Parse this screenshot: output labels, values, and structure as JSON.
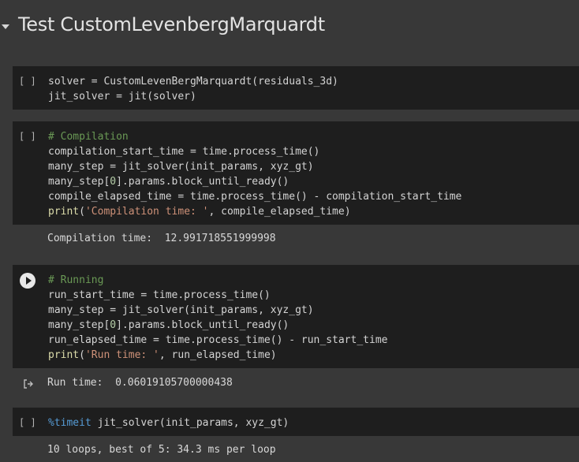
{
  "section": {
    "title": "Test CustomLevenbergMarquardt",
    "collapse_icon": "caret-down-icon"
  },
  "cells": [
    {
      "gutter": "[ ]",
      "lines": [
        [
          {
            "t": "solver = CustomLevenBergMarquardt(residuals_3d)",
            "c": ""
          }
        ],
        [
          {
            "t": "jit_solver = jit(solver)",
            "c": ""
          }
        ]
      ]
    },
    {
      "gutter": "[ ]",
      "lines": [
        [
          {
            "t": "# Compilation",
            "c": "tok-comment"
          }
        ],
        [
          {
            "t": "compilation_start_time = time.process_time()",
            "c": ""
          }
        ],
        [
          {
            "t": "many_step = jit_solver(init_params, xyz_gt)",
            "c": ""
          }
        ],
        [
          {
            "t": "many_step[",
            "c": ""
          },
          {
            "t": "0",
            "c": "tok-number"
          },
          {
            "t": "].params.block_until_ready()",
            "c": ""
          }
        ],
        [
          {
            "t": "compile_elapsed_time = time.process_time() - compilation_start_time",
            "c": ""
          }
        ],
        [
          {
            "t": "print",
            "c": "tok-builtin"
          },
          {
            "t": "(",
            "c": ""
          },
          {
            "t": "'Compilation time: '",
            "c": "tok-string"
          },
          {
            "t": ", compile_elapsed_time)",
            "c": ""
          }
        ]
      ],
      "output": "Compilation time:  12.991718551999998"
    },
    {
      "gutter_icon": "run-cell-icon",
      "lines": [
        [
          {
            "t": "# Running",
            "c": "tok-comment"
          }
        ],
        [
          {
            "t": "run_start_time = time.process_time()",
            "c": ""
          }
        ],
        [
          {
            "t": "many_step = jit_solver(init_params, xyz_gt)",
            "c": ""
          }
        ],
        [
          {
            "t": "many_step[",
            "c": ""
          },
          {
            "t": "0",
            "c": "tok-number"
          },
          {
            "t": "].params.block_until_ready()",
            "c": ""
          }
        ],
        [
          {
            "t": "run_elapsed_time = time.process_time() - run_start_time",
            "c": ""
          }
        ],
        [
          {
            "t": "print",
            "c": "tok-builtin"
          },
          {
            "t": "(",
            "c": ""
          },
          {
            "t": "'Run time: '",
            "c": "tok-string"
          },
          {
            "t": ", run_elapsed_time)",
            "c": ""
          }
        ]
      ],
      "output_icon": "output-arrow-icon",
      "output": "Run time:  0.06019105700000438"
    },
    {
      "gutter": "[ ]",
      "lines": [
        [
          {
            "t": "%timeit",
            "c": "tok-magic"
          },
          {
            "t": " jit_solver(init_params, xyz_gt)",
            "c": ""
          }
        ]
      ],
      "output": "10 loops, best of 5: 34.3 ms per loop"
    }
  ],
  "colors": {
    "background": "#383838",
    "cell_background": "#1e1e1e",
    "comment": "#6a9955",
    "string": "#ce9178",
    "number": "#b5cea8",
    "builtin": "#dcdcaa",
    "magic": "#569cd6"
  }
}
